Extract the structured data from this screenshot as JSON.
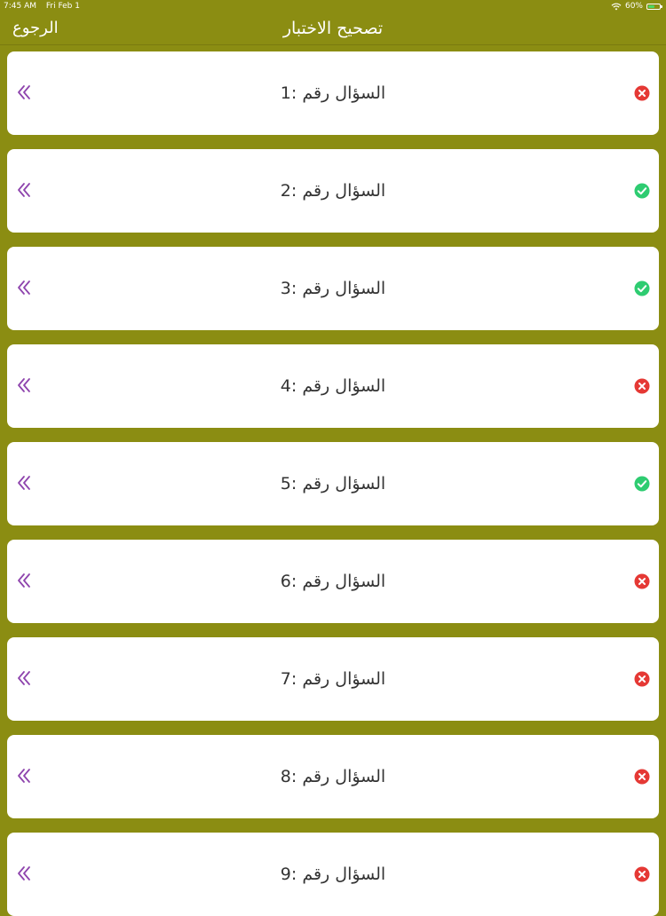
{
  "status_bar": {
    "time": "7:45 AM",
    "date": "Fri Feb 1",
    "battery": "60%",
    "battery_level": 0.6,
    "battery_color": "#4cd964"
  },
  "nav": {
    "title": "تصحيح الاختبار",
    "back_label": "الرجوع"
  },
  "colors": {
    "background": "#8b8d12",
    "card": "#ffffff",
    "chevron": "#8e44ad",
    "correct": "#2ecc71",
    "wrong": "#e53935"
  },
  "questions": [
    {
      "label": "السؤال رقم :1",
      "status": "wrong",
      "icon": "x-circle-icon",
      "action_icon": "double-chevron-left-icon"
    },
    {
      "label": "السؤال رقم :2",
      "status": "correct",
      "icon": "check-circle-icon",
      "action_icon": "double-chevron-left-icon"
    },
    {
      "label": "السؤال رقم :3",
      "status": "correct",
      "icon": "check-circle-icon",
      "action_icon": "double-chevron-left-icon"
    },
    {
      "label": "السؤال رقم :4",
      "status": "wrong",
      "icon": "x-circle-icon",
      "action_icon": "double-chevron-left-icon"
    },
    {
      "label": "السؤال رقم :5",
      "status": "correct",
      "icon": "check-circle-icon",
      "action_icon": "double-chevron-left-icon"
    },
    {
      "label": "السؤال رقم :6",
      "status": "wrong",
      "icon": "x-circle-icon",
      "action_icon": "double-chevron-left-icon"
    },
    {
      "label": "السؤال رقم :7",
      "status": "wrong",
      "icon": "x-circle-icon",
      "action_icon": "double-chevron-left-icon"
    },
    {
      "label": "السؤال رقم :8",
      "status": "wrong",
      "icon": "x-circle-icon",
      "action_icon": "double-chevron-left-icon"
    },
    {
      "label": "السؤال رقم :9",
      "status": "wrong",
      "icon": "x-circle-icon",
      "action_icon": "double-chevron-left-icon"
    }
  ]
}
